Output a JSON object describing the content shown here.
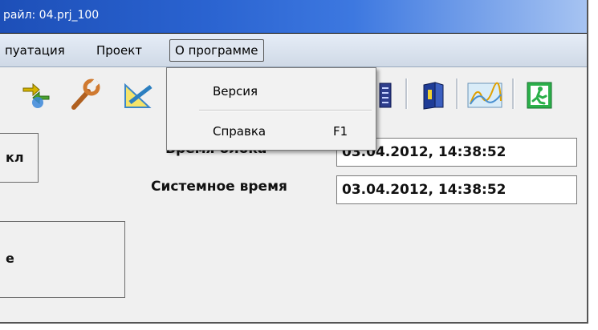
{
  "window": {
    "title": "райл: 04.prj_100"
  },
  "menubar": {
    "items": [
      {
        "label": "пуатация"
      },
      {
        "label": "Проект"
      },
      {
        "label": "О программе"
      }
    ]
  },
  "dropdown": {
    "items": [
      {
        "label": "Версия",
        "shortcut": ""
      },
      {
        "label": "Справка",
        "shortcut": "F1"
      }
    ]
  },
  "fields": {
    "block_time": {
      "label": "Время блока",
      "value": "03.04.2012, 14:38:52"
    },
    "system_time": {
      "label": "Системное время",
      "value": "03.04.2012, 14:38:52"
    }
  },
  "buttons": {
    "top_left": "кл",
    "bottom_left": "е"
  },
  "toolbar": {
    "icons": [
      "sync-arrows-icon",
      "wrench-icon",
      "ruler-pencil-icon",
      "list-document-icon",
      "book-icon",
      "chart-icon",
      "exit-icon"
    ]
  },
  "colors": {
    "titlebar": "#2a63d0",
    "menu_bg": "#dfe6f0",
    "dropdown_bg": "#f2f2f2"
  }
}
